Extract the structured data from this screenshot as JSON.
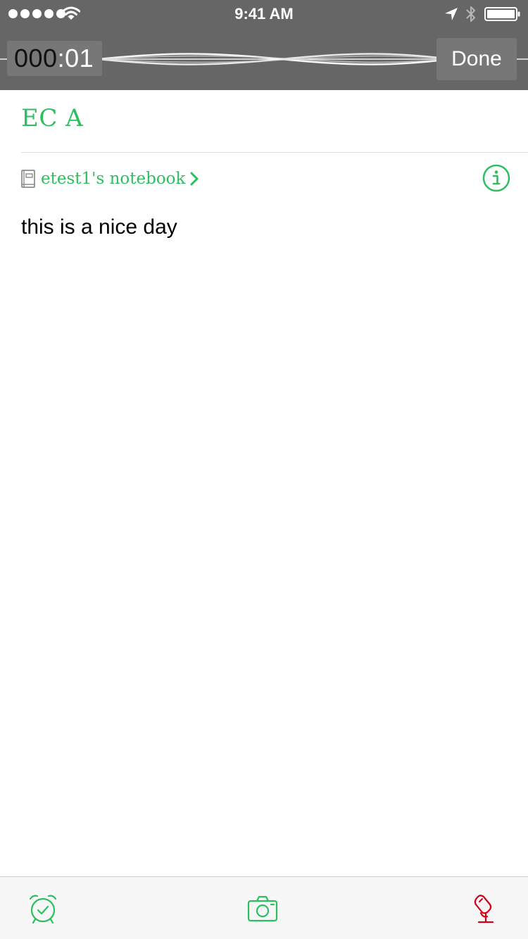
{
  "status_bar": {
    "time": "9:41 AM",
    "signal_dots": 5
  },
  "recording": {
    "timer_lead": "000",
    "timer_rest": ":01",
    "done_label": "Done"
  },
  "note": {
    "title": "EC A",
    "notebook": "etest1's notebook",
    "body": "this is a nice day"
  },
  "toolbar": {
    "icons": [
      "alarm-clock-icon",
      "camera-icon",
      "microphone-icon"
    ]
  },
  "colors": {
    "accent": "#2dbe60",
    "recording": "#d0021b",
    "header_bg": "#666666"
  }
}
